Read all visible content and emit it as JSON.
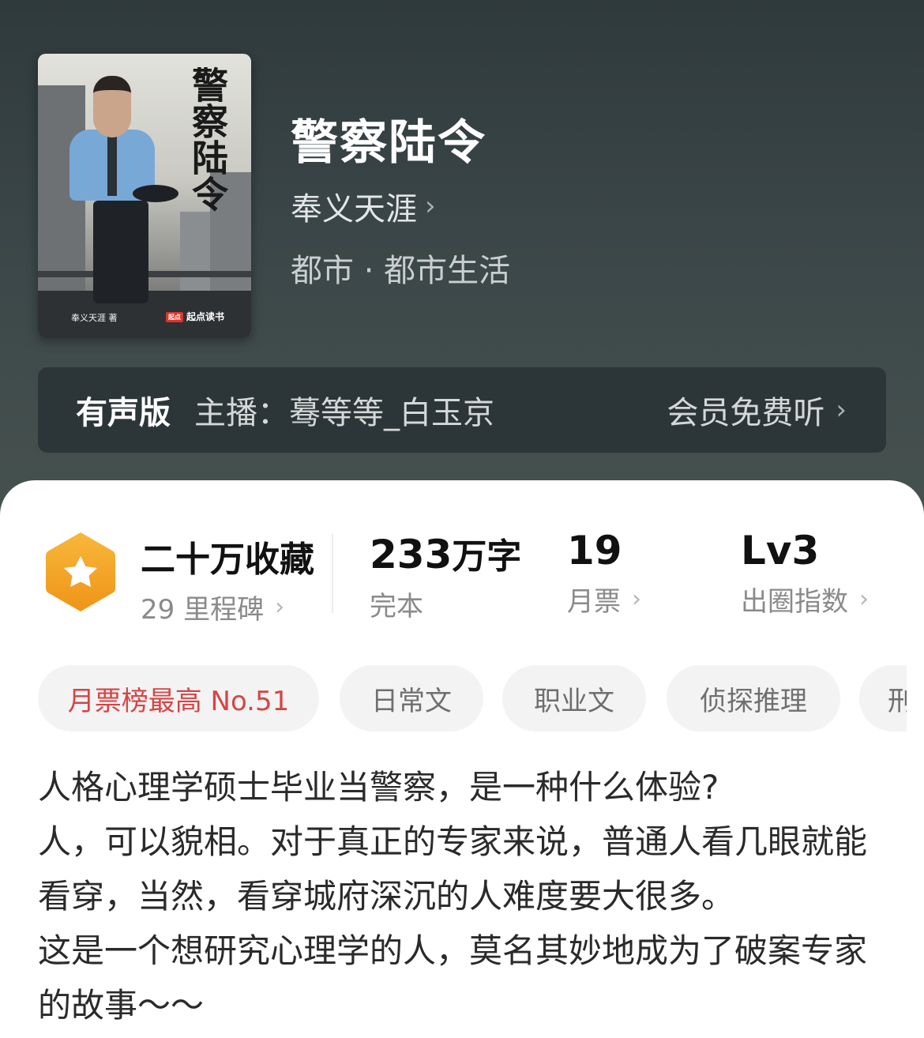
{
  "book": {
    "cover": {
      "calligraphy": "警察陆令",
      "author_tag": "奉义天涯 著",
      "publisher": "起点读书",
      "publisher_logo": "起点"
    },
    "title": "警察陆令",
    "author": "奉义天涯",
    "genre": "都市 · 都市生活"
  },
  "audio": {
    "label": "有声版",
    "anchor": "主播：蓦等等_白玉京",
    "action": "会员免费听"
  },
  "stats": {
    "collection": {
      "main": "二十万收藏",
      "sub": "29 里程碑"
    },
    "words": {
      "num": "233",
      "unit": "万字",
      "sub": "完本"
    },
    "tickets": {
      "num": "19",
      "sub": "月票"
    },
    "index": {
      "num": "Lv3",
      "sub": "出圈指数"
    }
  },
  "tags": [
    {
      "label": "月票榜最高 No.51"
    },
    {
      "label": "日常文"
    },
    {
      "label": "职业文"
    },
    {
      "label": "侦探推理"
    },
    {
      "label": "刑"
    }
  ],
  "description": [
    "人格心理学硕士毕业当警察，是一种什么体验?",
    "人，可以貌相。对于真正的专家来说，普通人看几眼就能看穿，当然，看穿城府深沉的人难度要大很多。",
    "这是一个想研究心理学的人，莫名其妙地成为了破案专家的故事～～"
  ],
  "colors": {
    "header_bg": "#3b4648",
    "audio_bar_bg": "#2c3537",
    "badge_orange": "#f3a21f",
    "hot_tag_red": "#d64545"
  },
  "icons": {
    "badge": "star-hexagon-icon",
    "chevron": "chevron-right-icon"
  }
}
